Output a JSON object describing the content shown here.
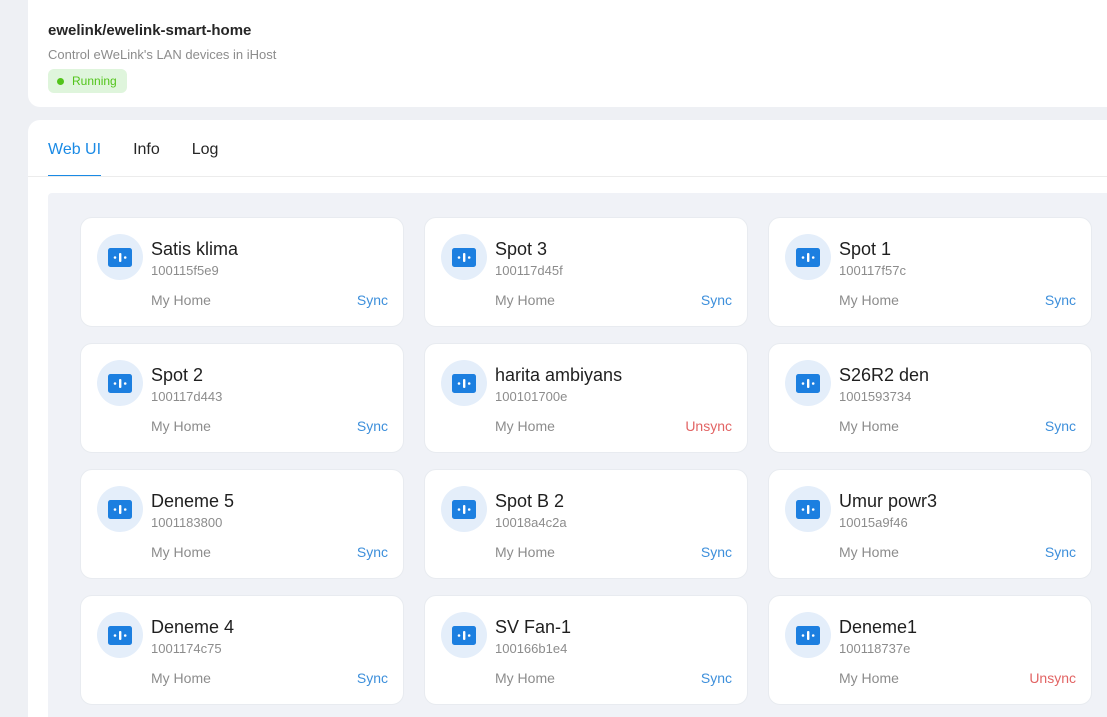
{
  "app": {
    "title": "ewelink/ewelink-smart-home",
    "description": "Control eWeLink's LAN devices in iHost",
    "status": "Running"
  },
  "tabs": [
    {
      "label": "Web UI",
      "active": true
    },
    {
      "label": "Info",
      "active": false
    },
    {
      "label": "Log",
      "active": false
    }
  ],
  "colors": {
    "accent": "#1a8ae5",
    "running": "#52c41a",
    "sync": "#3d8fdb",
    "unsync": "#e26464"
  },
  "devices": [
    {
      "name": "Satis klima",
      "id": "100115f5e9",
      "home": "My Home",
      "action": "Sync",
      "icon": "switch-device-icon"
    },
    {
      "name": "Spot 3",
      "id": "100117d45f",
      "home": "My Home",
      "action": "Sync",
      "icon": "switch-device-icon"
    },
    {
      "name": "Spot 1",
      "id": "100117f57c",
      "home": "My Home",
      "action": "Sync",
      "icon": "switch-device-icon"
    },
    {
      "name": "Spot 2",
      "id": "100117d443",
      "home": "My Home",
      "action": "Sync",
      "icon": "switch-device-icon"
    },
    {
      "name": "harita ambiyans",
      "id": "100101700e",
      "home": "My Home",
      "action": "Unsync",
      "icon": "switch-device-icon"
    },
    {
      "name": "S26R2 den",
      "id": "1001593734",
      "home": "My Home",
      "action": "Sync",
      "icon": "switch-device-icon"
    },
    {
      "name": "Deneme 5",
      "id": "1001183800",
      "home": "My Home",
      "action": "Sync",
      "icon": "switch-device-icon"
    },
    {
      "name": "Spot B 2",
      "id": "10018a4c2a",
      "home": "My Home",
      "action": "Sync",
      "icon": "switch-device-icon"
    },
    {
      "name": "Umur powr3",
      "id": "10015a9f46",
      "home": "My Home",
      "action": "Sync",
      "icon": "switch-device-icon"
    },
    {
      "name": "Deneme 4",
      "id": "1001174c75",
      "home": "My Home",
      "action": "Sync",
      "icon": "switch-device-icon"
    },
    {
      "name": "SV Fan-1",
      "id": "100166b1e4",
      "home": "My Home",
      "action": "Sync",
      "icon": "switch-device-icon"
    },
    {
      "name": "Deneme1",
      "id": "100118737e",
      "home": "My Home",
      "action": "Unsync",
      "icon": "switch-device-icon"
    }
  ]
}
